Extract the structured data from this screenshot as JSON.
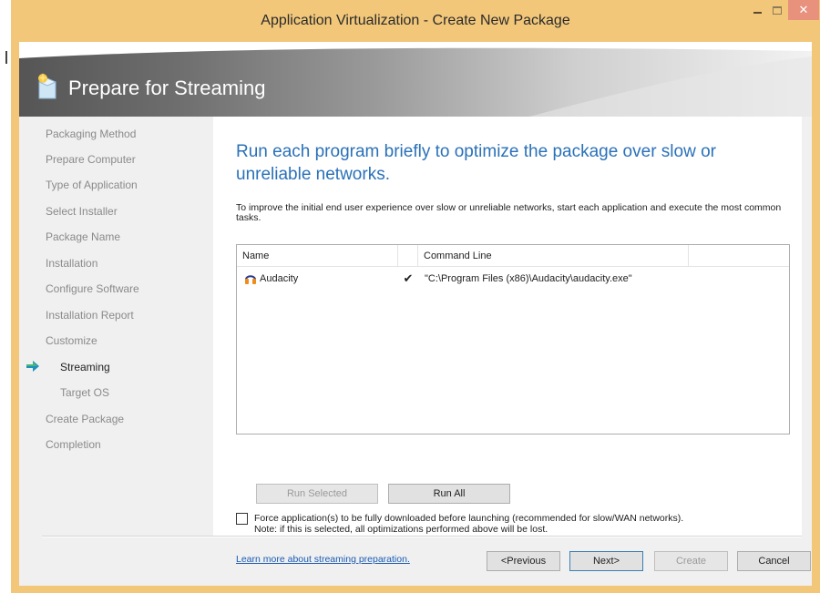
{
  "window": {
    "title": "Application Virtualization - Create New Package",
    "close_glyph": "✕"
  },
  "banner": {
    "title": "Prepare for Streaming",
    "icon": "package-wizard-icon"
  },
  "sidebar": {
    "items": [
      {
        "label": "Packaging Method",
        "state": "done"
      },
      {
        "label": "Prepare Computer",
        "state": "done"
      },
      {
        "label": "Type of Application",
        "state": "done"
      },
      {
        "label": "Select Installer",
        "state": "done"
      },
      {
        "label": "Package Name",
        "state": "done"
      },
      {
        "label": "Installation",
        "state": "done"
      },
      {
        "label": "Configure Software",
        "state": "done"
      },
      {
        "label": "Installation Report",
        "state": "done"
      },
      {
        "label": "Customize",
        "state": "done"
      },
      {
        "label": "Streaming",
        "state": "active"
      },
      {
        "label": "Target OS",
        "state": "pending"
      },
      {
        "label": "Create Package",
        "state": "pending"
      },
      {
        "label": "Completion",
        "state": "pending"
      }
    ],
    "active_arrow_color": "#1f8fbf"
  },
  "main": {
    "heading": "Run each program briefly to optimize the package over slow or unreliable networks.",
    "description": "To improve the initial end user experience over slow or unreliable networks, start each application and execute the most common tasks.",
    "table": {
      "columns": [
        "Name",
        "",
        "Command Line"
      ],
      "rows": [
        {
          "name": "Audacity",
          "run_mark": "✔",
          "command_line": "\"C:\\Program Files (x86)\\Audacity\\audacity.exe\""
        }
      ]
    },
    "run_selected_label": "Run Selected",
    "run_all_label": "Run All",
    "force_download_label": "Force application(s) to be fully downloaded before launching (recommended for slow/WAN networks).",
    "force_download_note": "Note: if this is selected, all optimizations performed above will be lost.",
    "force_download_checked": false,
    "learn_more_link": "Learn more about streaming preparation."
  },
  "footer": {
    "previous_label": "<Previous",
    "next_label": "Next>",
    "create_label": "Create",
    "cancel_label": "Cancel"
  },
  "colors": {
    "titlebar": "#f2c77a",
    "close_button": "#e8917d",
    "heading": "#2a71b8",
    "link": "#1a5ab4"
  }
}
